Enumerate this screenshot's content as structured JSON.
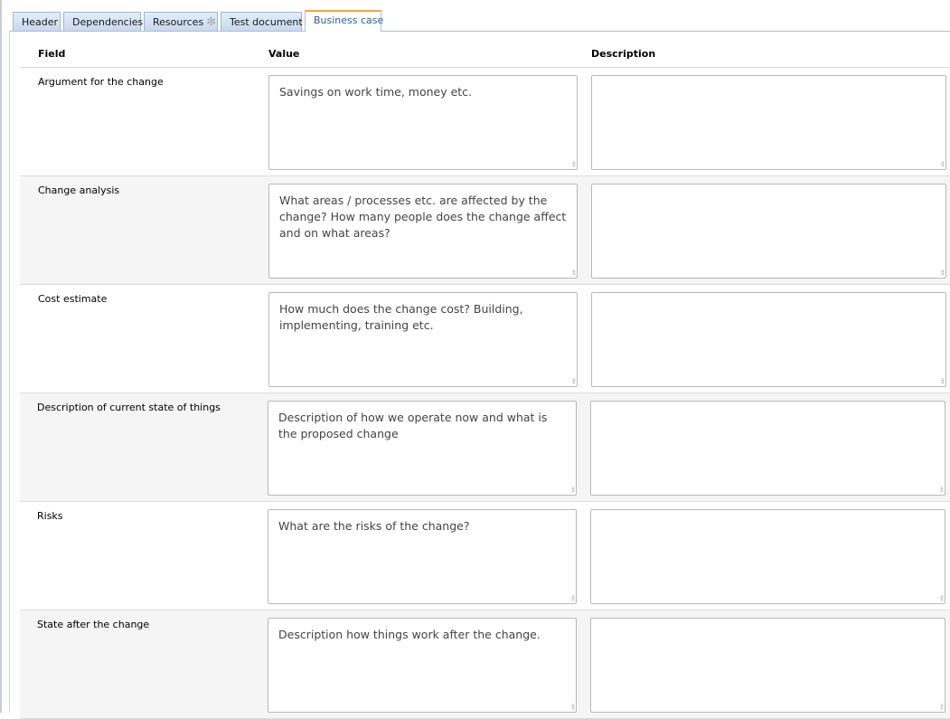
{
  "tabs": [
    {
      "label": "Header",
      "active": false
    },
    {
      "label": "Dependencies",
      "active": false
    },
    {
      "label": "Resources",
      "active": false,
      "icon": "gear-icon"
    },
    {
      "label": "Test document",
      "active": false
    },
    {
      "label": "Business case",
      "active": true
    }
  ],
  "table": {
    "headers": {
      "field": "Field",
      "value": "Value",
      "description": "Description"
    },
    "rows": [
      {
        "field": "Argument for the change",
        "value": "Savings on work time, money etc.",
        "description": ""
      },
      {
        "field": "Change analysis",
        "value": "What areas / processes etc. are affected by the change? How many people does the change affect and on what areas?",
        "description": ""
      },
      {
        "field": "Cost estimate",
        "value": "How much does the change cost? Building, implementing, training etc.",
        "description": ""
      },
      {
        "field": "Description of current state of things",
        "value": "Description of how we operate now and what is the proposed change",
        "description": ""
      },
      {
        "field": "Risks",
        "value": "What are the risks of the change?",
        "description": ""
      },
      {
        "field": "State after the change",
        "value": "Description how things work after the change.",
        "description": ""
      }
    ]
  },
  "colors": {
    "tab_active_accent": "#f0a542",
    "tab_bg": "#c5d7ee",
    "row_alt_bg": "#f5f5f5"
  }
}
